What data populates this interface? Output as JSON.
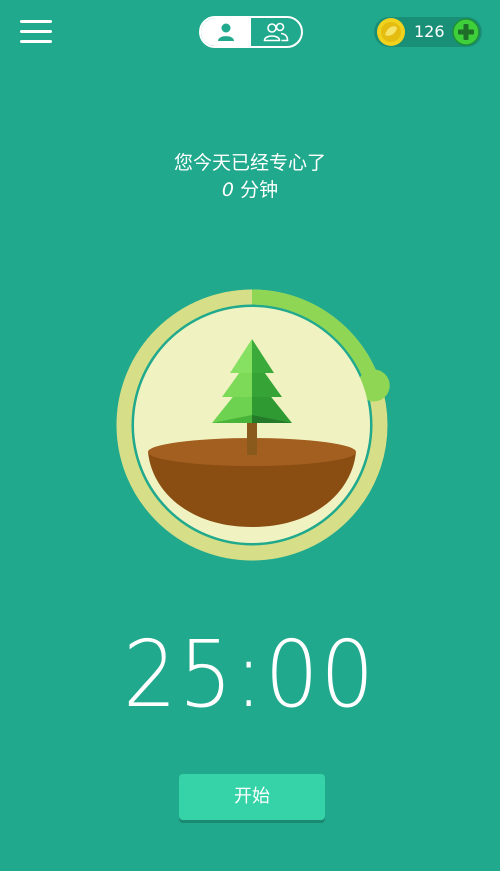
{
  "header": {
    "menu_icon": "hamburger-menu-icon",
    "mode_toggle": {
      "options": [
        {
          "icon": "single-user-icon",
          "active": true
        },
        {
          "icon": "group-users-icon",
          "active": false
        }
      ]
    },
    "coins": {
      "icon": "coin-icon",
      "count": "126",
      "add_icon": "plus-icon"
    }
  },
  "focus_summary": {
    "title": "您今天已经专心了",
    "minutes": "0",
    "unit": "分钟"
  },
  "timer": {
    "display": "25:00",
    "progress_fraction": 0.2
  },
  "start_button": {
    "label": "开始"
  },
  "colors": {
    "background": "#21a98d",
    "ring_track": "#d6df87",
    "ring_progress": "#8ed653",
    "tree_disc": "#f0f2c1",
    "soil": "#8a4d12",
    "soil_top": "#a35f1f",
    "tree_light": "#6cd24f",
    "tree_dark": "#2f9a32",
    "start_button": "#36d3a8",
    "coin": "#f1d21c",
    "add_button": "#3fcf3a"
  }
}
